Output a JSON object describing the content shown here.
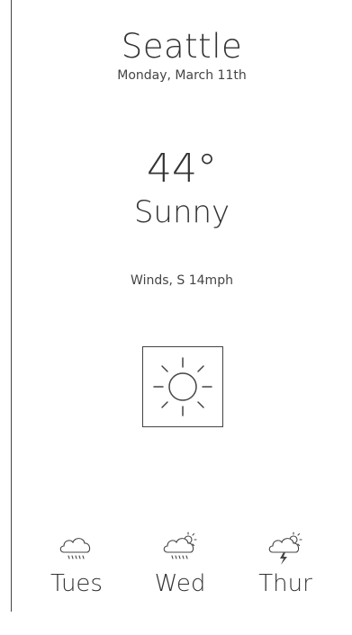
{
  "current": {
    "city": "Seattle",
    "date": "Monday, March 11th",
    "temperature": "44°",
    "condition": "Sunny",
    "winds": "Winds, S 14mph",
    "icon": "sun-icon"
  },
  "forecast": [
    {
      "day": "Tues",
      "icon": "rain-cloud-icon"
    },
    {
      "day": "Wed",
      "icon": "sun-rain-cloud-icon"
    },
    {
      "day": "Thur",
      "icon": "sun-thunder-cloud-icon"
    }
  ],
  "colors": {
    "text": "#333333",
    "stroke": "#444444",
    "background": "#ffffff"
  }
}
